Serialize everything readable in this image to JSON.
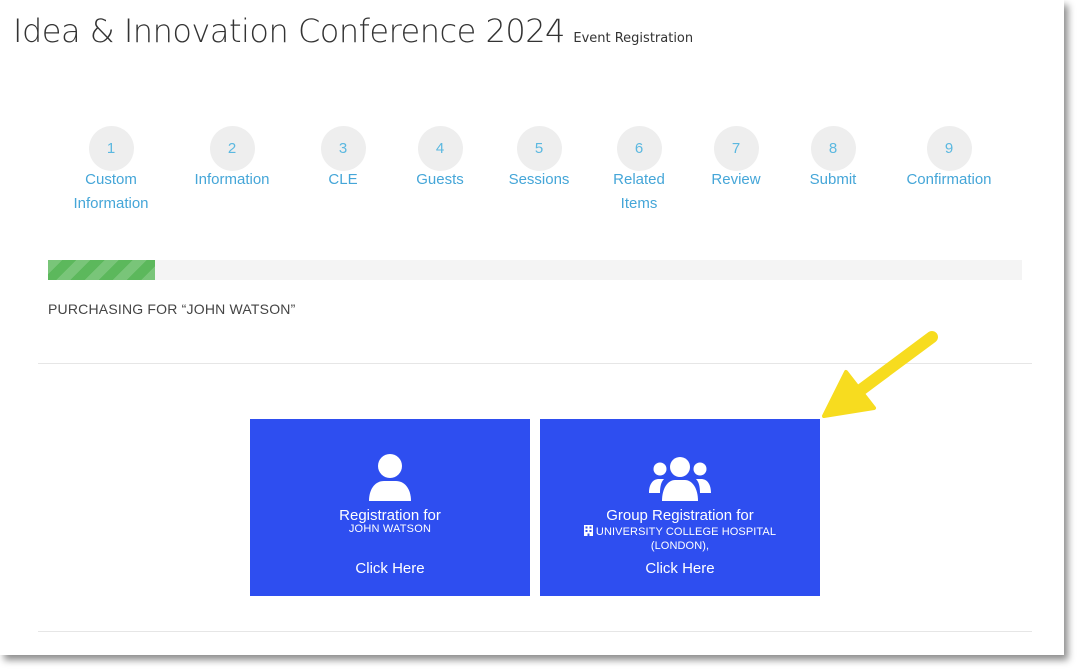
{
  "header": {
    "title": "Idea & Innovation Conference 2024",
    "subtitle": "Event Registration"
  },
  "steps": [
    {
      "number": "1",
      "label_line1": "Custom",
      "label_line2": "Information"
    },
    {
      "number": "2",
      "label_line1": "Information",
      "label_line2": ""
    },
    {
      "number": "3",
      "label_line1": "CLE",
      "label_line2": ""
    },
    {
      "number": "4",
      "label_line1": "Guests",
      "label_line2": ""
    },
    {
      "number": "5",
      "label_line1": "Sessions",
      "label_line2": ""
    },
    {
      "number": "6",
      "label_line1": "Related",
      "label_line2": "Items"
    },
    {
      "number": "7",
      "label_line1": "Review",
      "label_line2": ""
    },
    {
      "number": "8",
      "label_line1": "Submit",
      "label_line2": ""
    },
    {
      "number": "9",
      "label_line1": "Confirmation",
      "label_line2": ""
    }
  ],
  "progress": {
    "percent": 11
  },
  "purchasing_text": "PURCHASING FOR “JOHN WATSON”",
  "cards": {
    "single": {
      "title": "Registration for",
      "name": "JOHN WATSON",
      "action": "Click Here",
      "icon": "user-icon"
    },
    "group": {
      "title": "Group Registration for",
      "org_line1": "UNIVERSITY COLLEGE HOSPITAL",
      "org_line2": "(LONDON),",
      "action": "Click Here",
      "icon": "users-group-icon",
      "org_icon": "building-icon"
    }
  },
  "colors": {
    "card_bg": "#2e4ef0",
    "step_text": "#45a6d8",
    "progress_fill": "#5cb85c",
    "annotation_arrow": "#f7dc1f"
  }
}
